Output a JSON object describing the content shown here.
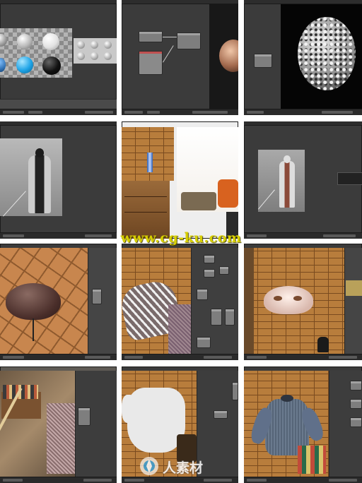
{
  "watermark": {
    "text": "www.cg-ku.com"
  },
  "logo_watermark": {
    "text": "人素材"
  },
  "tiles": [
    {
      "name": "material-preview-spheres"
    },
    {
      "name": "node-editor-shader"
    },
    {
      "name": "rendered-stone-sphere"
    },
    {
      "name": "ninja-character-render"
    },
    {
      "name": "room-photo-reference"
    },
    {
      "name": "ninja-character-render-2"
    },
    {
      "name": "hat-on-tiled-floor"
    },
    {
      "name": "textured-mesh-brick-wall"
    },
    {
      "name": "mask-on-brick-wall"
    },
    {
      "name": "mirror-room-photo"
    },
    {
      "name": "white-torso-brick-wall"
    },
    {
      "name": "shirt-torso-brick-wall"
    }
  ]
}
